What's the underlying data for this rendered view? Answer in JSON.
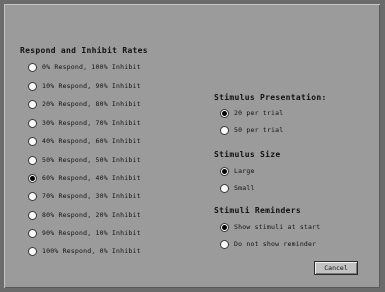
{
  "respond_inhibit": {
    "heading": "Respond and Inhibit Rates",
    "selected_index": 6,
    "options": [
      "0% Respond, 100% Inhibit",
      "10% Respond, 90% Inhibit",
      "20% Respond, 80% Inhibit",
      "30% Respond, 70% Inhibit",
      "40% Respond, 60% Inhibit",
      "50% Respond, 50% Inhibit",
      "60% Respond, 40% Inhibit",
      "70% Respond, 30% Inhibit",
      "80% Respond, 20% Inhibit",
      "90% Respond, 10% Inhibit",
      "100% Respond, 0% Inhibit"
    ]
  },
  "stimulus_presentation": {
    "heading": "Stimulus Presentation:",
    "selected_index": 0,
    "options": [
      "20 per trial",
      "50 per trial"
    ]
  },
  "stimulus_size": {
    "heading": "Stimulus Size",
    "selected_index": 0,
    "options": [
      "Large",
      "Small"
    ]
  },
  "stimuli_reminders": {
    "heading": "Stimuli Reminders",
    "selected_index": 0,
    "options": [
      "Show stimuli at start",
      "Do not show reminder"
    ]
  },
  "button_label": "Cancel"
}
